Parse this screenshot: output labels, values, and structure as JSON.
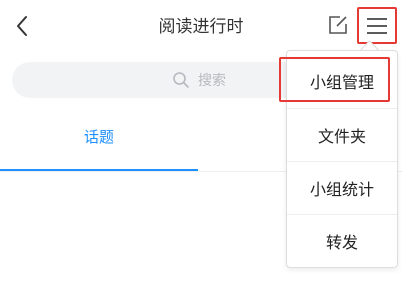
{
  "header": {
    "title": "阅读进行时",
    "back_icon": "chevron-left-icon",
    "edit_icon": "edit-icon",
    "menu_icon": "hamburger-menu-icon"
  },
  "search": {
    "placeholder": "搜索",
    "icon": "search-icon"
  },
  "tabs": {
    "active_label": "话题",
    "active_color": "#1e90ff"
  },
  "menu": {
    "items": [
      {
        "label": "小组管理",
        "highlighted": true
      },
      {
        "label": "文件夹"
      },
      {
        "label": "小组统计"
      },
      {
        "label": "转发"
      }
    ],
    "highlight_color": "#e53935"
  }
}
